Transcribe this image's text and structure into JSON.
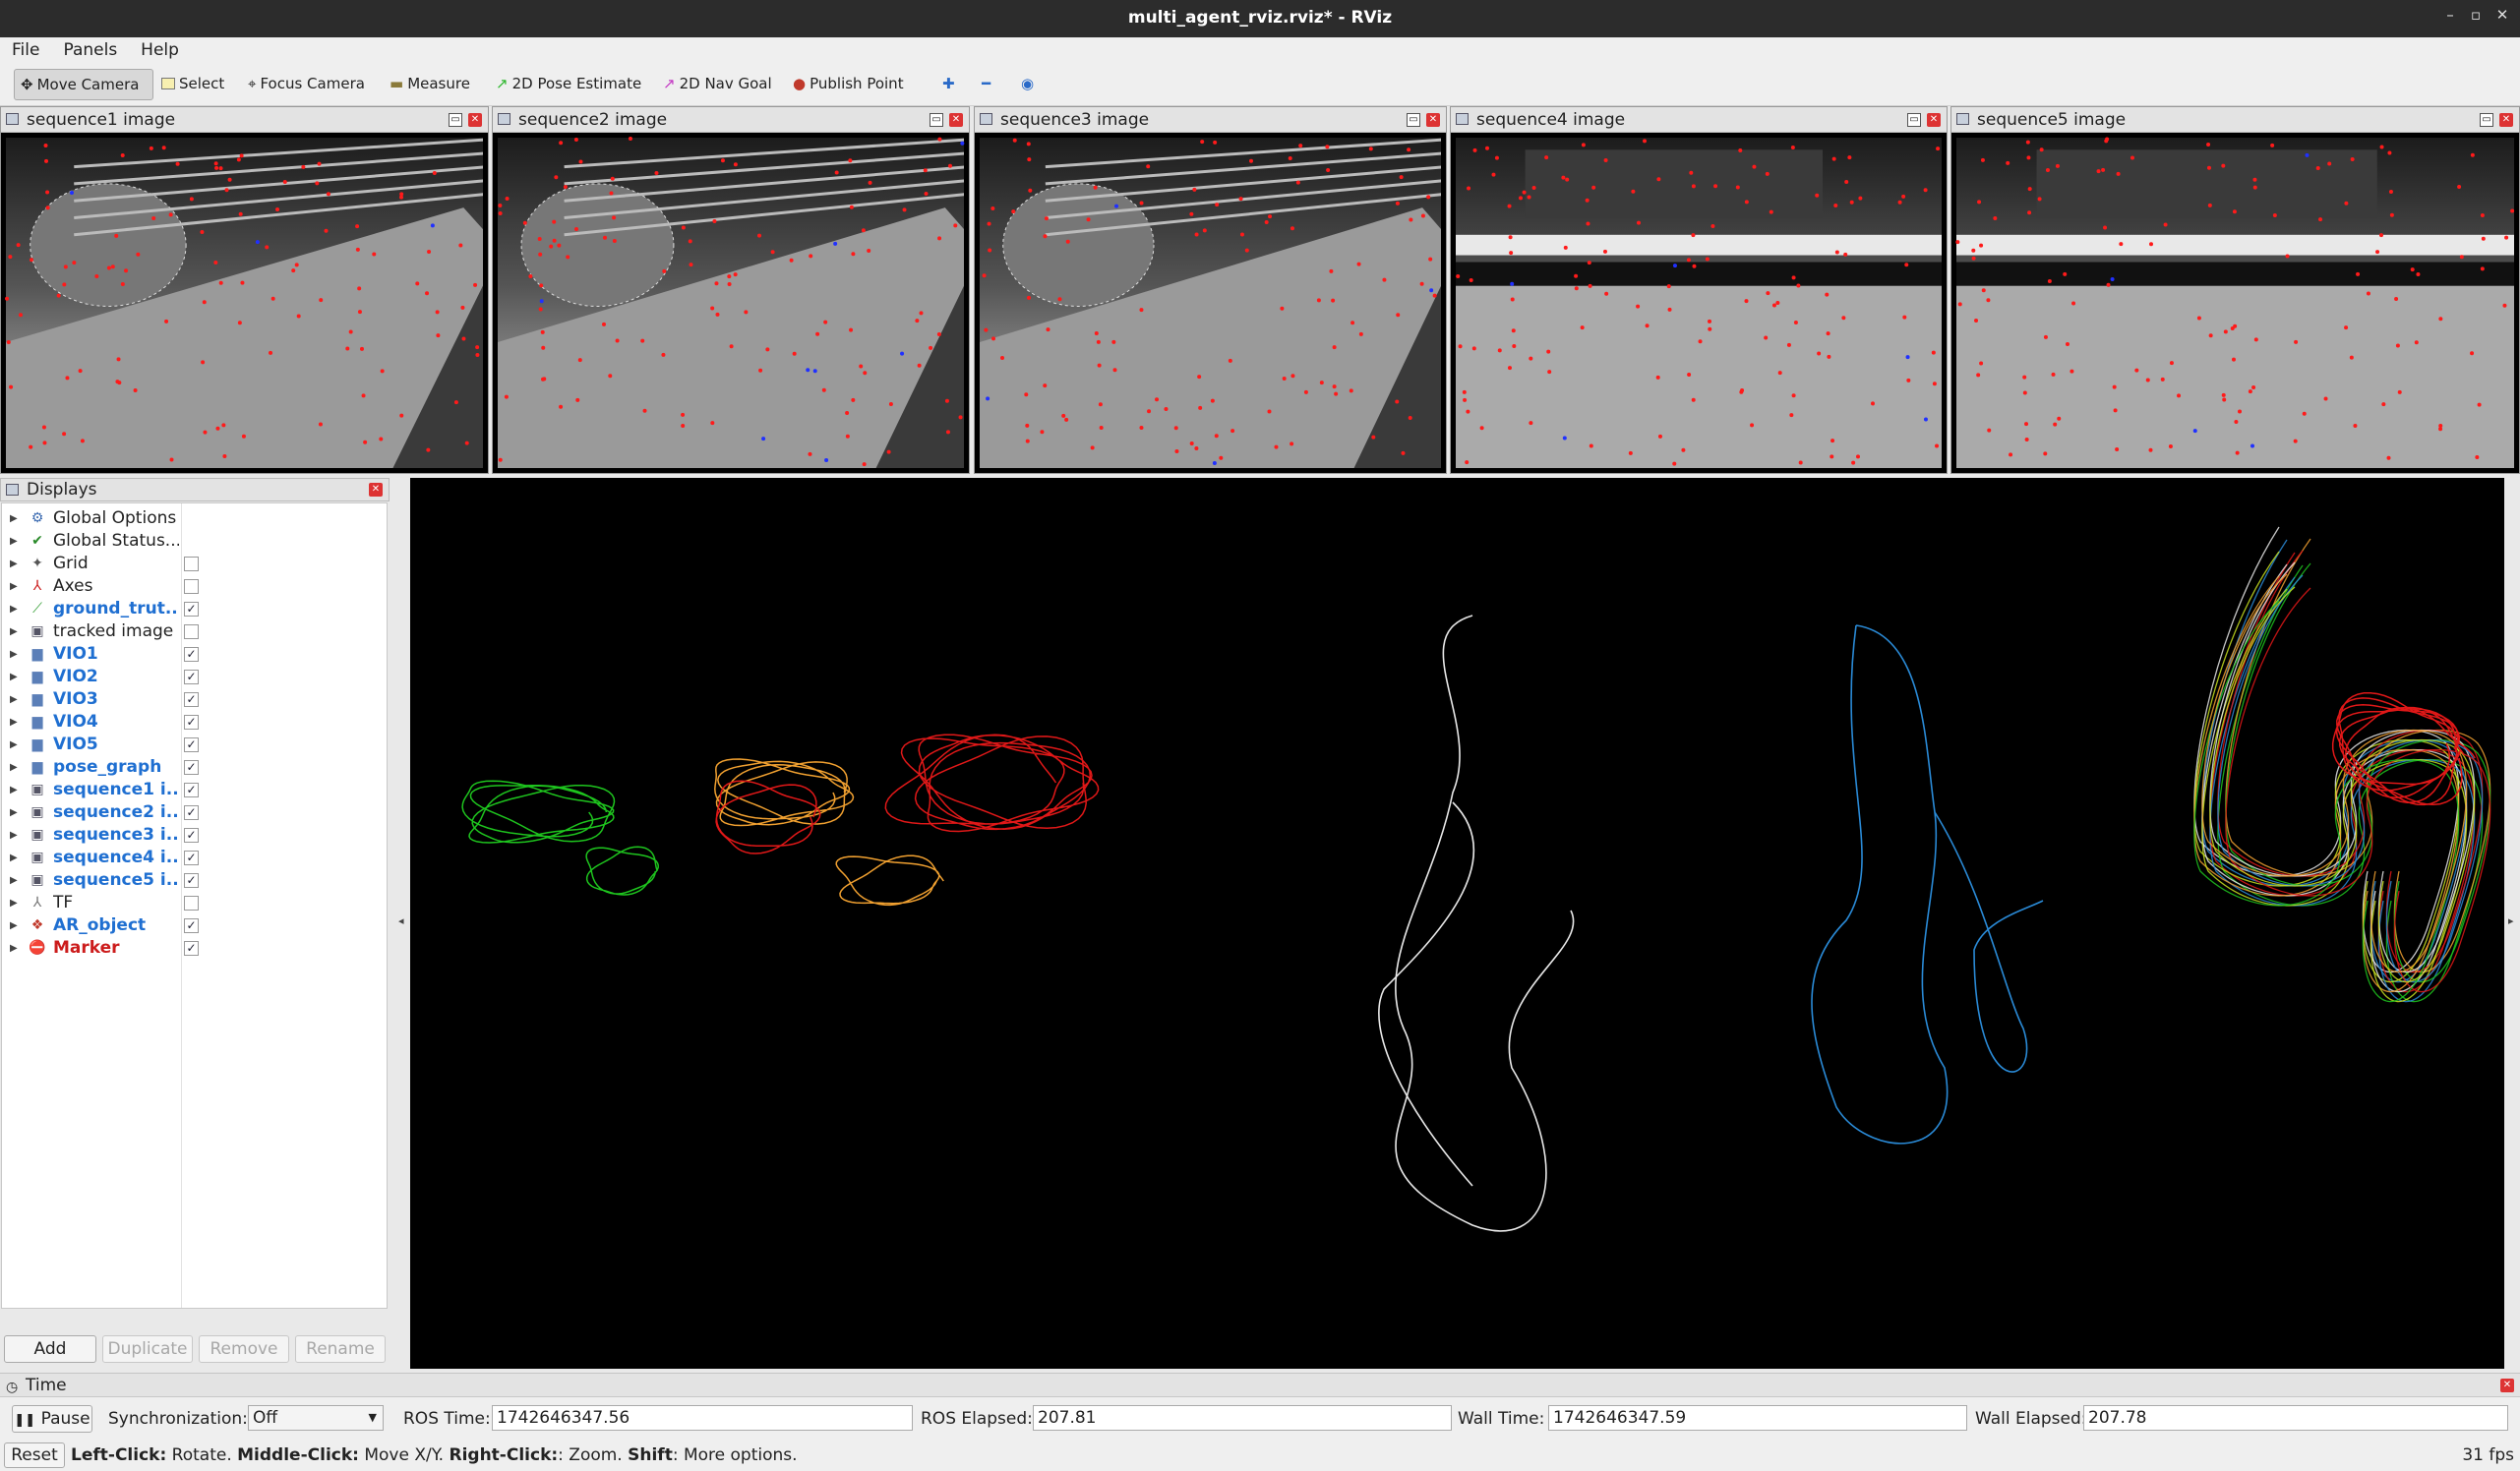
{
  "window": {
    "title": "multi_agent_rviz.rviz* - RViz"
  },
  "menu": [
    "File",
    "Panels",
    "Help"
  ],
  "toolbar": {
    "tools": [
      "Move Camera",
      "Select",
      "Focus Camera",
      "Measure",
      "2D Pose Estimate",
      "2D Nav Goal",
      "Publish Point"
    ],
    "active_tool": "Move Camera"
  },
  "image_panels": [
    {
      "title": "sequence1 image"
    },
    {
      "title": "sequence2 image"
    },
    {
      "title": "sequence3 image"
    },
    {
      "title": "sequence4 image"
    },
    {
      "title": "sequence5 image"
    }
  ],
  "displays": {
    "title": "Displays",
    "items": [
      {
        "label": "Global Options",
        "icon": "gear-icon",
        "checked": null,
        "style": "normal"
      },
      {
        "label": "Global Status...",
        "icon": "check-icon",
        "checked": null,
        "style": "normal"
      },
      {
        "label": "Grid",
        "icon": "grid-icon",
        "checked": false,
        "style": "normal"
      },
      {
        "label": "Axes",
        "icon": "axes-icon",
        "checked": false,
        "style": "normal"
      },
      {
        "label": "ground_trut...",
        "icon": "path-icon",
        "checked": true,
        "style": "blue"
      },
      {
        "label": "tracked image",
        "icon": "image-icon",
        "checked": false,
        "style": "normal"
      },
      {
        "label": "VIO1",
        "icon": "folder-icon",
        "checked": true,
        "style": "blue"
      },
      {
        "label": "VIO2",
        "icon": "folder-icon",
        "checked": true,
        "style": "blue"
      },
      {
        "label": "VIO3",
        "icon": "folder-icon",
        "checked": true,
        "style": "blue"
      },
      {
        "label": "VIO4",
        "icon": "folder-icon",
        "checked": true,
        "style": "blue"
      },
      {
        "label": "VIO5",
        "icon": "folder-icon",
        "checked": true,
        "style": "blue"
      },
      {
        "label": "pose_graph",
        "icon": "folder-icon",
        "checked": true,
        "style": "blue"
      },
      {
        "label": "sequence1 i...",
        "icon": "image-icon",
        "checked": true,
        "style": "blue"
      },
      {
        "label": "sequence2 i...",
        "icon": "image-icon",
        "checked": true,
        "style": "blue"
      },
      {
        "label": "sequence3 i...",
        "icon": "image-icon",
        "checked": true,
        "style": "blue"
      },
      {
        "label": "sequence4 i...",
        "icon": "image-icon",
        "checked": true,
        "style": "blue"
      },
      {
        "label": "sequence5 i...",
        "icon": "image-icon",
        "checked": true,
        "style": "blue"
      },
      {
        "label": "TF",
        "icon": "tf-icon",
        "checked": false,
        "style": "normal"
      },
      {
        "label": "AR_object",
        "icon": "cluster-icon",
        "checked": true,
        "style": "blue"
      },
      {
        "label": "Marker",
        "icon": "marker-icon",
        "checked": true,
        "style": "red"
      }
    ],
    "buttons": {
      "add": "Add",
      "duplicate": "Duplicate",
      "remove": "Remove",
      "rename": "Rename"
    }
  },
  "trajectories": {
    "colors": {
      "seq1": "#1ec41e",
      "seq2": "#f0a030",
      "seq3": "#e01818",
      "seq4": "#e8e8e8",
      "seq5": "#2a8ad6",
      "merged": "multi"
    }
  },
  "time_panel": {
    "title": "Time",
    "pause_label": "Pause",
    "sync_label": "Synchronization:",
    "sync_value": "Off",
    "ros_time_label": "ROS Time:",
    "ros_time": "1742646347.56",
    "ros_elapsed_label": "ROS Elapsed:",
    "ros_elapsed": "207.81",
    "wall_time_label": "Wall Time:",
    "wall_time": "1742646347.59",
    "wall_elapsed_label": "Wall Elapsed:",
    "wall_elapsed": "207.78"
  },
  "status": {
    "reset_label": "Reset",
    "left_click_key": "Left-Click:",
    "left_click_text": " Rotate. ",
    "middle_click_key": "Middle-Click:",
    "middle_click_text": " Move X/Y. ",
    "right_click_key": "Right-Click:",
    "right_click_text": ": Zoom. ",
    "shift_key": "Shift",
    "shift_text": ": More options.",
    "fps": "31 fps"
  }
}
